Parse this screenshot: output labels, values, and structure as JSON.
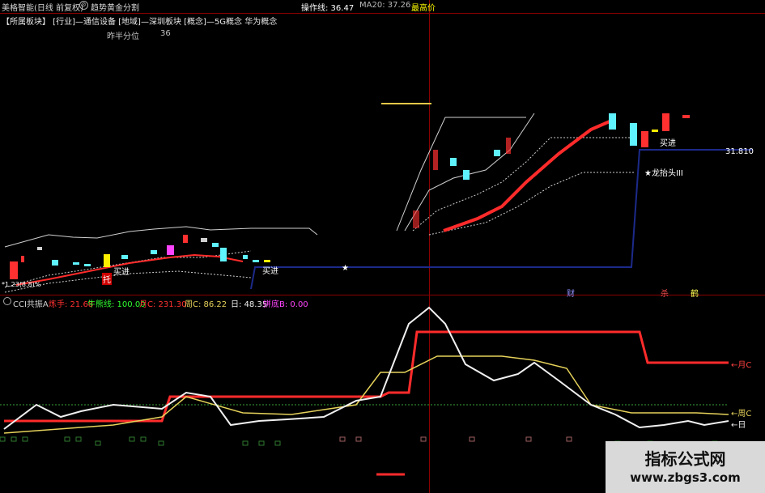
{
  "header": {
    "stock_name": "美格智能(日线 前复权)",
    "indicator_name": "趋势黄金分割",
    "op_line_label": "操作线: 36.47",
    "ma20_label": "MA20: 37.26",
    "high_label": "最高价"
  },
  "info": {
    "sectors": "【所属板块】 [行业]—通信设备 [地域]—深圳板块 [概念]—5G概念 华为概念",
    "rank_label": "昨半分位",
    "rank_value": "36"
  },
  "price_chart": {
    "price_label_right": "31.810",
    "buy_signal_1": "买进",
    "buy_signal_2": "买进",
    "buy_signal_3": "买进",
    "dragon_label": "★龙抬头III",
    "tuo_label": "托",
    "bottom_left_tag": "*1.23(8.8)%",
    "marks": [
      "财",
      "杀",
      "鹤"
    ]
  },
  "indicator": {
    "name": "CCI共振A",
    "lian_shou_label": "炼手: 21.68",
    "niu_xiong_label": "牛熊线: 100.00",
    "yue_c_label": "月C: 231.30",
    "zhou_c_label": "周C: 86.22",
    "ri_label": "日: 48.35",
    "pin_di_label": "拼底B: 0.00",
    "right_labels": [
      "←月C",
      "←周C",
      "←日"
    ]
  },
  "colors": {
    "border": "#8a0000",
    "red_line": "#ff2b2b",
    "yellow_line": "#e6d25a",
    "white_line": "#f0f0f0",
    "up_candle": "#ff3030",
    "down_candle": "#5ff2ff",
    "navy_line": "#1c2a8a"
  },
  "watermark": {
    "title": "指标公式网",
    "url": "www.zbgs3.com"
  }
}
